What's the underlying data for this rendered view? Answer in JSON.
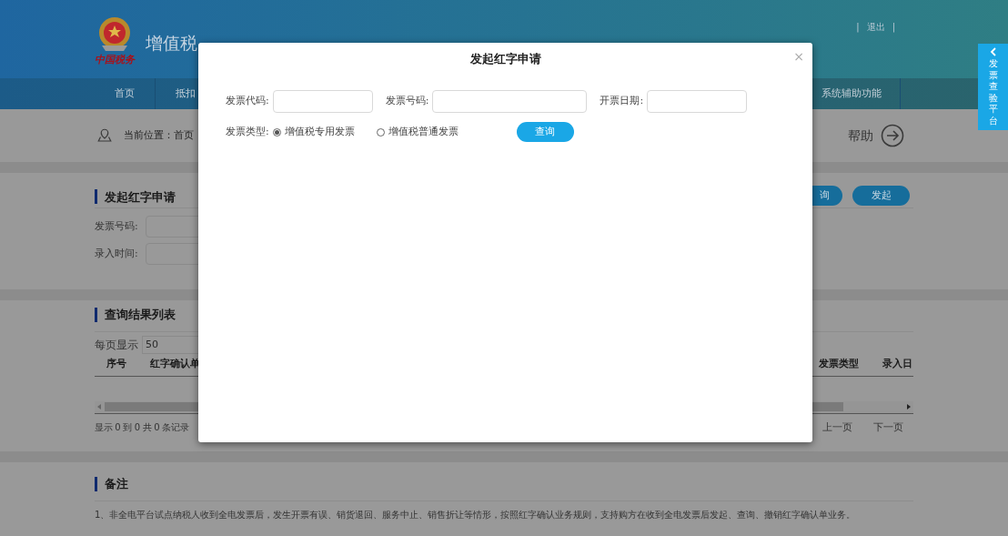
{
  "header": {
    "logo_caption": "中国税务",
    "title": "增值税",
    "links": [
      "|",
      "退出",
      "|"
    ]
  },
  "nav": {
    "items": [
      {
        "label": "首页"
      },
      {
        "label": "抵扣"
      }
    ],
    "right_items": [
      {
        "label": "系统辅助功能"
      }
    ]
  },
  "breadcrumb": {
    "text": "当前位置：首页",
    "help": "帮助"
  },
  "side_tab": {
    "label": "发票查验平台"
  },
  "apply_section": {
    "title": "发起红字申请",
    "fields": [
      {
        "label": "发票号码:"
      },
      {
        "label": "录入时间:"
      }
    ],
    "buttons": [
      "询",
      "发起"
    ]
  },
  "results_section": {
    "title": "查询结果列表",
    "page_size_label": "每页显示",
    "page_size": "50",
    "columns": [
      "序号",
      "红字确认单",
      "发票类型",
      "录入日"
    ],
    "summary": "显示 0 到 0 共 0 条记录",
    "prev": "上一页",
    "next": "下一页"
  },
  "notes_section": {
    "title": "备注",
    "text": "1、非全电平台试点纳税人收到全电发票后，发生开票有误、销货退回、服务中止、销售折让等情形，按照红字确认业务规则，支持购方在收到全电发票后发起、查询、撤销红字确认单业务。"
  },
  "modal": {
    "title": "发起红字申请",
    "close": "×",
    "fields": [
      {
        "label": "发票代码:"
      },
      {
        "label": "发票号码:"
      },
      {
        "label": "开票日期:"
      }
    ],
    "type_label": "发票类型:",
    "invoice_types": [
      {
        "label": "增值税专用发票",
        "selected": true
      },
      {
        "label": "增值税普通发票",
        "selected": false
      }
    ],
    "query_button": "查询"
  }
}
